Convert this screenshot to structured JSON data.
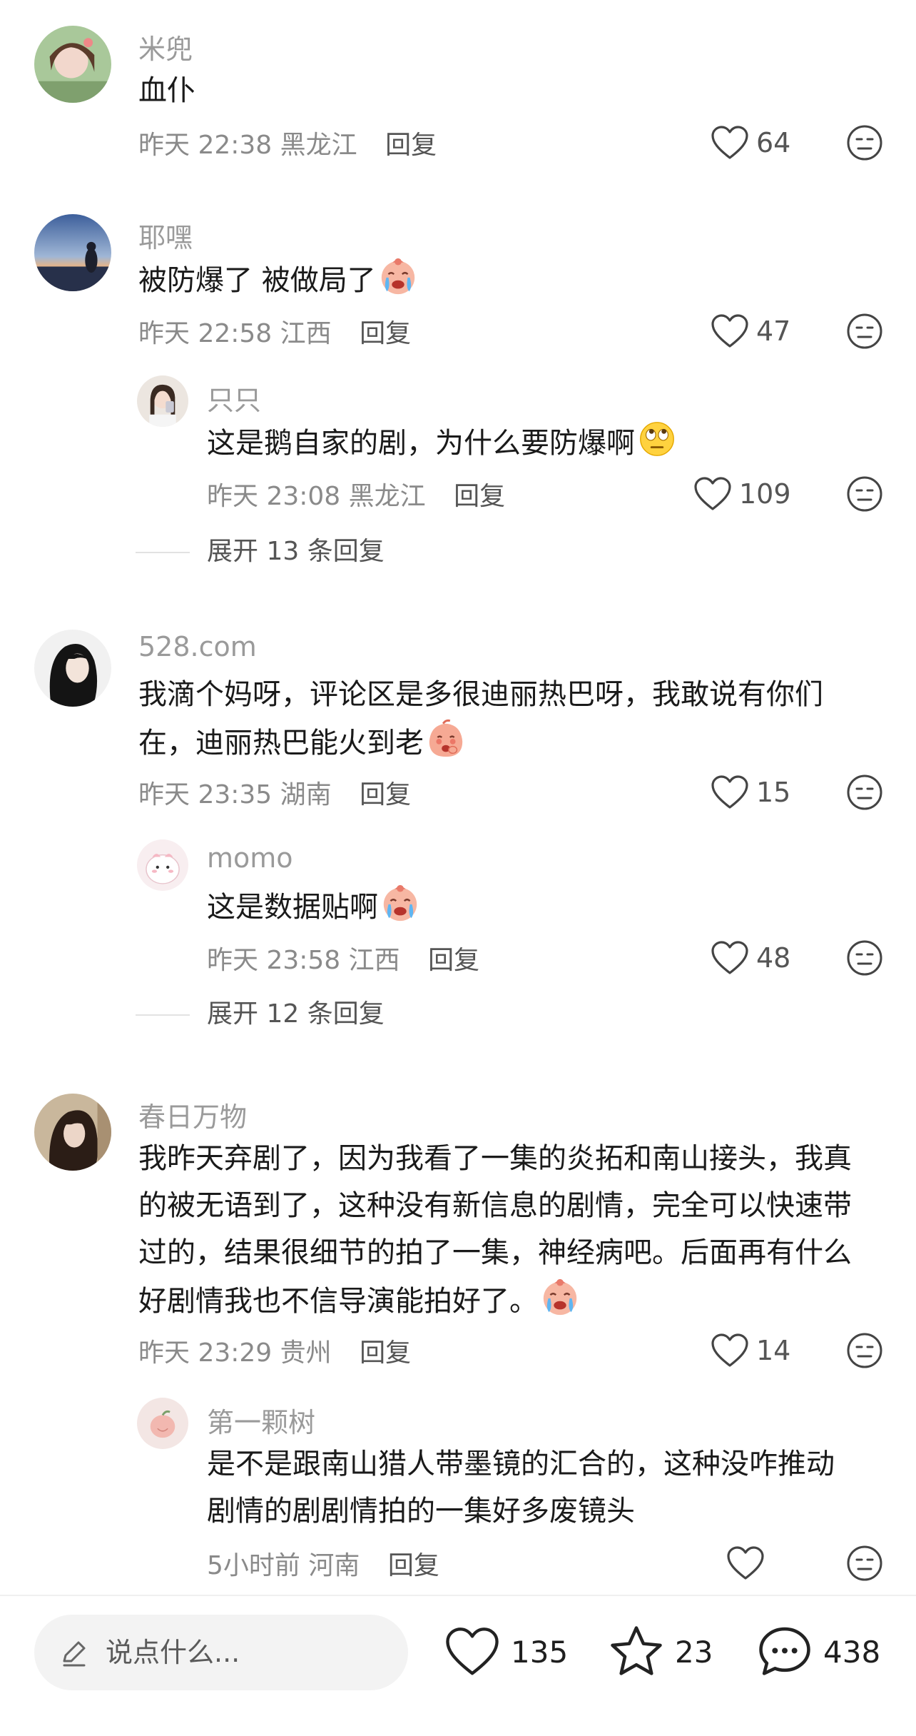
{
  "comments": [
    {
      "username": "米兜",
      "text": "血仆",
      "time": "昨天 22:38",
      "location": "黑龙江",
      "reply_label": "回复",
      "likes": "64",
      "replies": []
    },
    {
      "username": "耶嘿",
      "text": "被防爆了 被做局了",
      "time": "昨天 22:58",
      "location": "江西",
      "reply_label": "回复",
      "likes": "47",
      "emoji": "crying-face",
      "replies": [
        {
          "username": "只只",
          "text": "这是鹅自家的剧，为什么要防爆啊",
          "emoji": "eye-roll-face",
          "time": "昨天 23:08",
          "location": "黑龙江",
          "reply_label": "回复",
          "likes": "109"
        }
      ],
      "expand_label": "展开 13 条回复"
    },
    {
      "username": "528.com",
      "text_line1": "我滴个妈呀，评论区是多很迪丽热巴呀，我敢说有你们",
      "text_line2": "在，迪丽热巴能火到老",
      "emoji": "shy-peach-face",
      "time": "昨天 23:35",
      "location": "湖南",
      "reply_label": "回复",
      "likes": "15",
      "replies": [
        {
          "username": "momo",
          "text": "这是数据贴啊",
          "emoji": "crying-face",
          "time": "昨天 23:58",
          "location": "江西",
          "reply_label": "回复",
          "likes": "48"
        }
      ],
      "expand_label": "展开 12 条回复"
    },
    {
      "username": "春日万物",
      "text_lines": [
        "我昨天弃剧了，因为我看了一集的炎拓和南山接头，我真",
        "的被无语到了，这种没有新信息的剧情，完全可以快速带",
        "过的，结果很细节的拍了一集，神经病吧。后面再有什么",
        "好剧情我也不信导演能拍好了。"
      ],
      "emoji": "crying-face",
      "time": "昨天 23:29",
      "location": "贵州",
      "reply_label": "回复",
      "likes": "14",
      "replies": [
        {
          "username": "第一颗树",
          "text_lines": [
            "是不是跟南山猎人带墨镜的汇合的，这种没咋推动",
            "剧情的剧剧情拍的一集好多废镜头"
          ],
          "time": "5小时前",
          "location": "河南",
          "reply_label": "回复",
          "likes": ""
        }
      ]
    }
  ],
  "bottom_bar": {
    "input_placeholder": "说点什么...",
    "likes": "135",
    "favorites": "23",
    "comments": "438"
  }
}
